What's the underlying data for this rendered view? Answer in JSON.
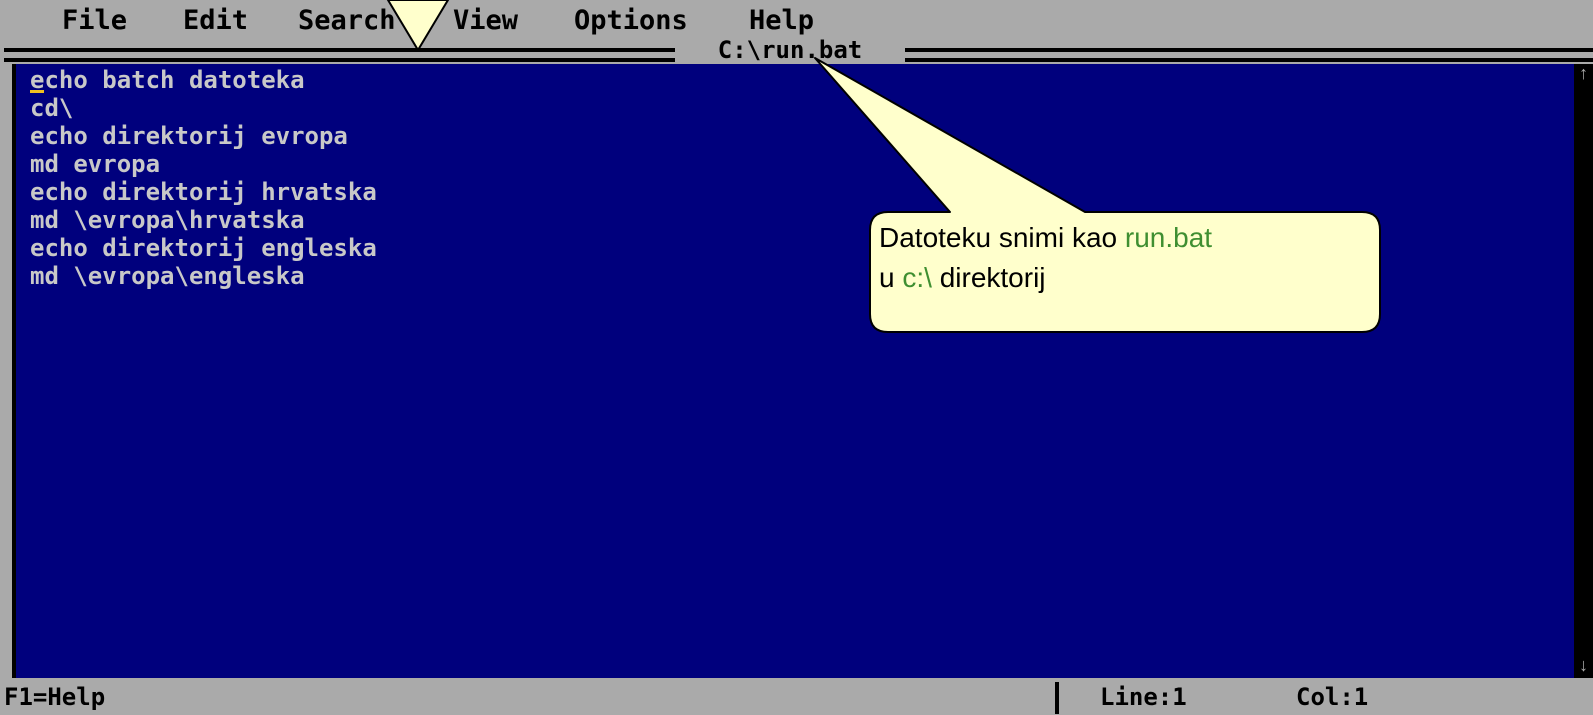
{
  "menu": {
    "items": [
      "File",
      "Edit",
      "Search",
      "View",
      "Options",
      "Help"
    ]
  },
  "editor": {
    "file_title": "C:\\run.bat",
    "lines": [
      "echo batch datoteka",
      "cd\\",
      "echo direktorij evropa",
      "md evropa",
      "echo direktorij hrvatska",
      "md \\evropa\\hrvatska",
      "echo direktorij engleska",
      "md \\evropa\\engleska"
    ],
    "first_char": "e",
    "first_line_rest": "cho batch datoteka"
  },
  "scrollbar": {
    "up_icon": "arrow-up-icon",
    "down_icon": "arrow-down-icon"
  },
  "status": {
    "help": "F1=Help",
    "line": "Line:1",
    "col": "Col:1"
  },
  "callout": {
    "line1_prefix": "Datoteku snimi kao ",
    "line1_highlight": "run.bat",
    "line2_prefix": "u ",
    "line2_highlight": "c:\\",
    "line2_suffix": " direktorij"
  },
  "colors": {
    "editor_background": "#00007d",
    "editor_text": "#c8c8c8",
    "chrome": "#aaaaaa",
    "callout_fill": "#ffffcc",
    "callout_highlight": "#3f8f31",
    "cursor": "#f0c020"
  }
}
